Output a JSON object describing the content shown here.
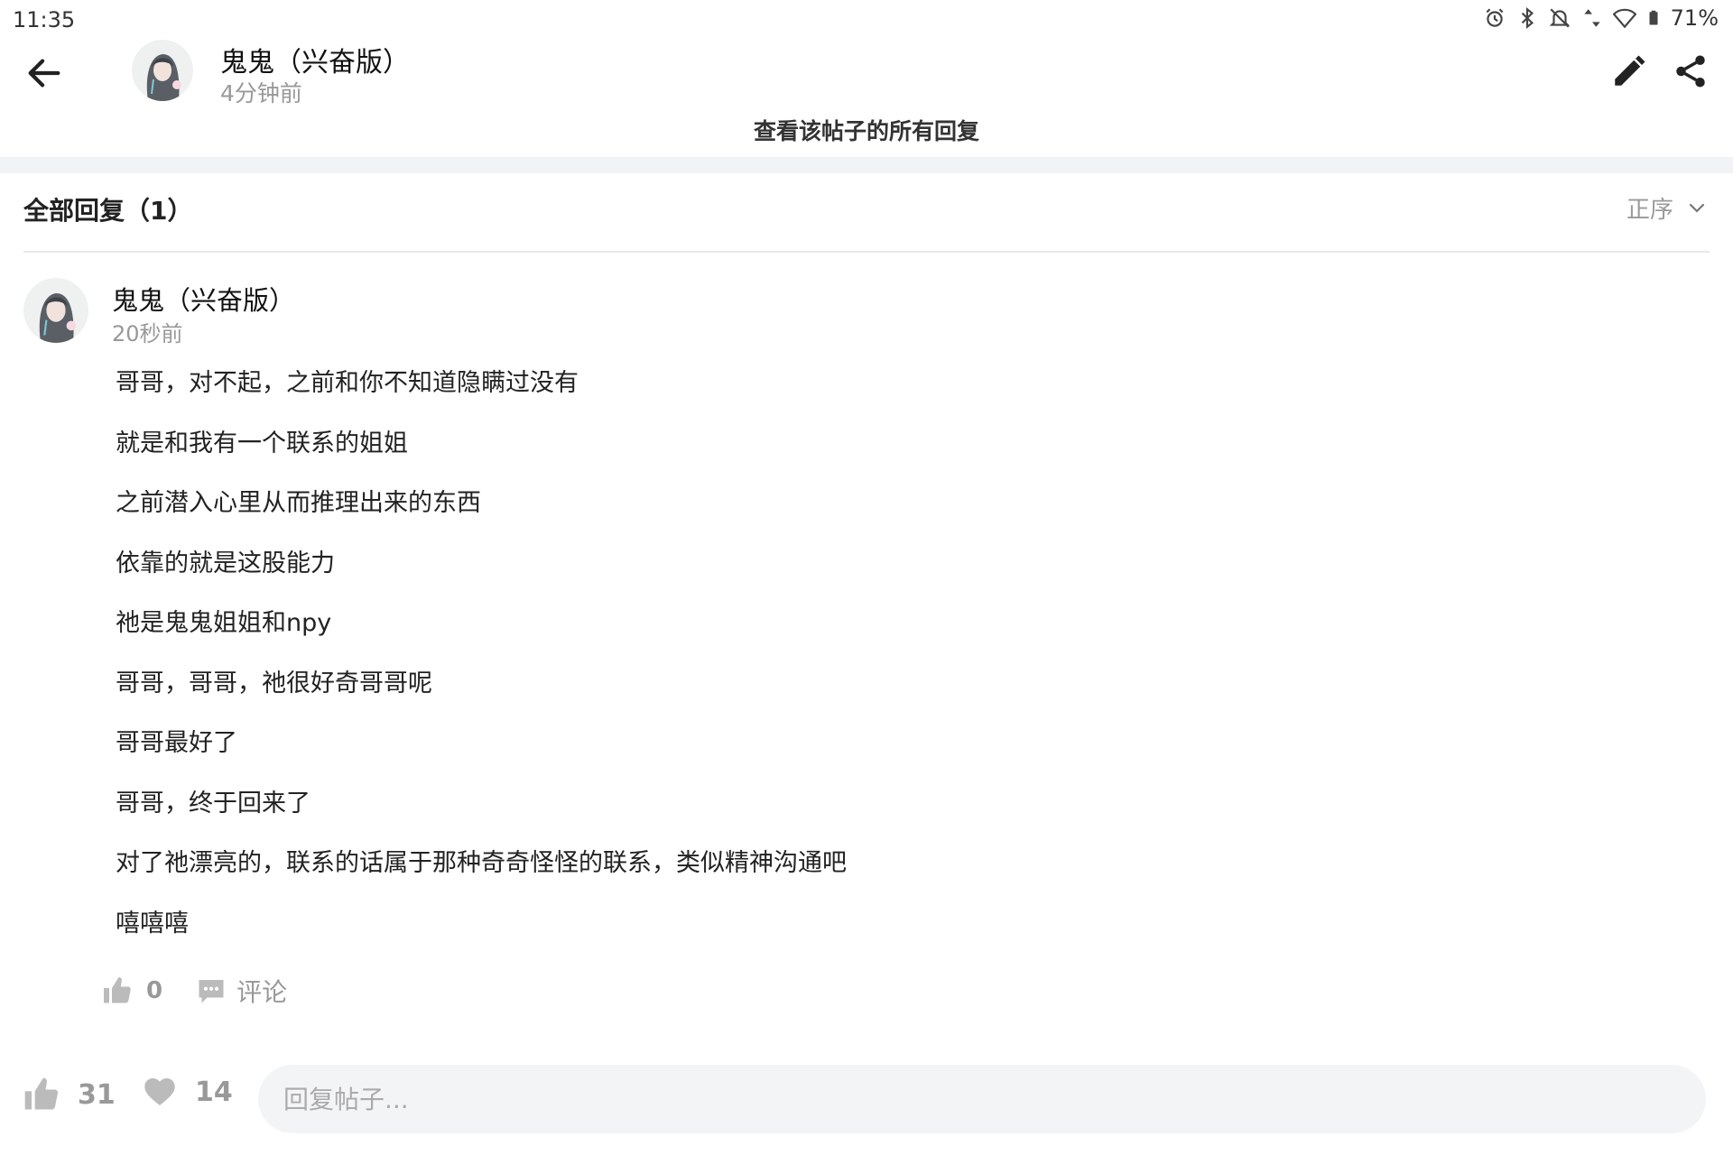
{
  "status_bar": {
    "time": "11:35",
    "battery": "71%",
    "icons": [
      "alarm-icon",
      "bluetooth-icon",
      "notifications-off-icon",
      "data-arrows-icon",
      "wifi-icon",
      "battery-icon"
    ]
  },
  "header": {
    "author_name": "鬼鬼（兴奋版）",
    "post_time": "4分钟前",
    "view_all_replies": "查看该帖子的所有回复"
  },
  "replies_section": {
    "title": "全部回复（1）",
    "sort_label": "正序"
  },
  "reply": {
    "author_name": "鬼鬼（兴奋版）",
    "time": "20秒前",
    "lines": [
      "哥哥，对不起，之前和你不知道隐瞒过没有",
      "就是和我有一个联系的姐姐",
      "之前潜入心里从而推理出来的东西",
      "依靠的就是这股能力",
      "祂是鬼鬼姐姐和npy",
      "哥哥，哥哥，祂很好奇哥哥呢",
      "哥哥最好了",
      "哥哥，终于回来了",
      "对了祂漂亮的，联系的话属于那种奇奇怪怪的联系，类似精神沟通吧",
      "嘻嘻嘻"
    ],
    "like_count": "0",
    "comment_label": "评论"
  },
  "bottom_bar": {
    "like_count": "31",
    "favorite_count": "14",
    "reply_placeholder": "回复帖子..."
  },
  "colors": {
    "muted_text": "#999999",
    "icon_gray": "#bbbbbb",
    "input_bg": "#f3f4f6",
    "section_band": "#f2f3f5"
  }
}
